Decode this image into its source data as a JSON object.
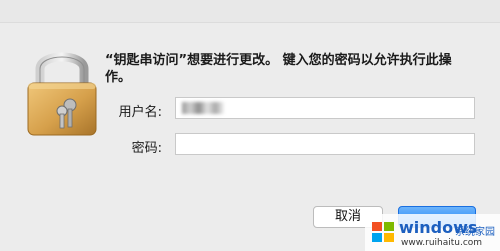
{
  "dialog": {
    "message": "“钥匙串访问”想要进行更改。 键入您的密码以允许执行此操作。",
    "username_label": "用户名:",
    "username_value": "",
    "password_label": "密码:",
    "password_value": "",
    "cancel_label": "取消",
    "ok_label": ""
  },
  "icons": {
    "lock": "padlock-with-keys-icon"
  },
  "watermark": {
    "brand": "windows",
    "sub": "系统家园",
    "url": "www.ruihaitu.com"
  },
  "colors": {
    "window_bg": "#ececec",
    "accent": "#1a82fb",
    "lock_gold": "#d9a24a"
  }
}
